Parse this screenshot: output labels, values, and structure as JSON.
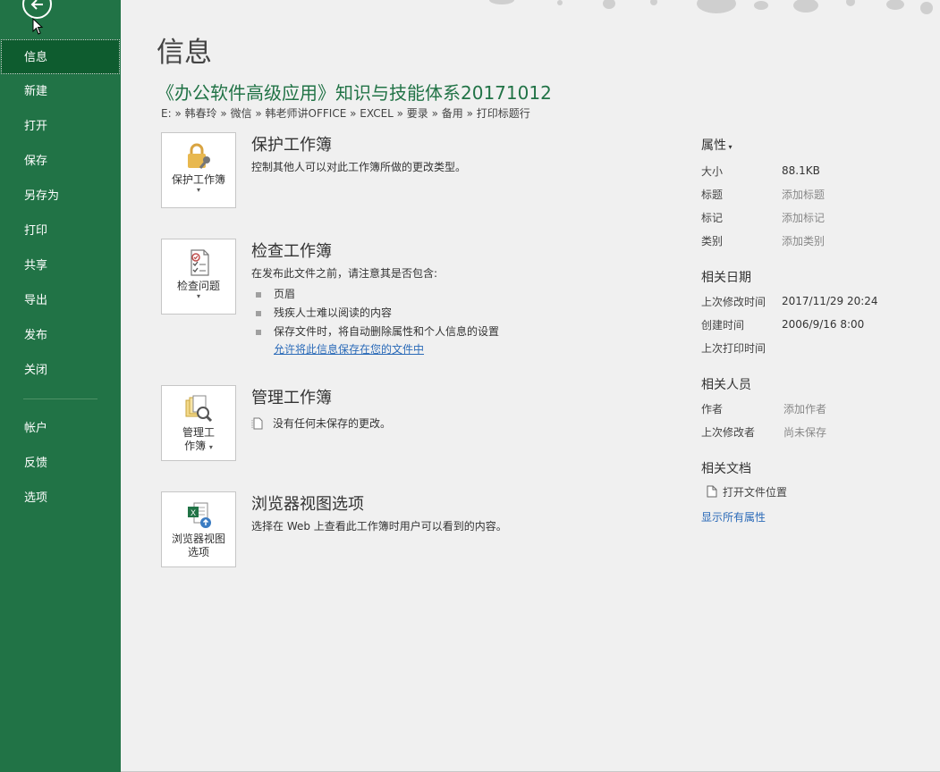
{
  "sidebar": {
    "items": [
      {
        "label": "信息",
        "active": true
      },
      {
        "label": "新建"
      },
      {
        "label": "打开"
      },
      {
        "label": "保存"
      },
      {
        "label": "另存为"
      },
      {
        "label": "打印"
      },
      {
        "label": "共享"
      },
      {
        "label": "导出"
      },
      {
        "label": "发布"
      },
      {
        "label": "关闭"
      }
    ],
    "bottom_items": [
      {
        "label": "帐户"
      },
      {
        "label": "反馈"
      },
      {
        "label": "选项"
      }
    ]
  },
  "main": {
    "page_title": "信息",
    "doc_title": "《办公软件高级应用》知识与技能体系20171012",
    "breadcrumb": "E: » 韩春玲 » 微信 » 韩老师讲OFFICE » EXCEL » 要录 » 备用 » 打印标题行",
    "protect": {
      "tile_label": "保护工作簿",
      "title": "保护工作簿",
      "desc": "控制其他人可以对此工作簿所做的更改类型。"
    },
    "inspect": {
      "tile_label": "检查问题",
      "title": "检查工作簿",
      "desc": "在发布此文件之前，请注意其是否包含:",
      "bullets": [
        "页眉",
        "残疾人士难以阅读的内容",
        "保存文件时，将自动删除属性和个人信息的设置"
      ],
      "link": "允许将此信息保存在您的文件中"
    },
    "manage": {
      "tile_label_1": "管理工",
      "tile_label_2": "作簿",
      "title": "管理工作簿",
      "status": "没有任何未保存的更改。"
    },
    "browser": {
      "tile_label_1": "浏览器视图",
      "tile_label_2": "选项",
      "title": "浏览器视图选项",
      "desc": "选择在 Web 上查看此工作簿时用户可以看到的内容。"
    }
  },
  "props": {
    "header": "属性",
    "rows": [
      {
        "k": "大小",
        "v": "88.1KB",
        "muted": false
      },
      {
        "k": "标题",
        "v": "添加标题",
        "muted": true
      },
      {
        "k": "标记",
        "v": "添加标记",
        "muted": true
      },
      {
        "k": "类别",
        "v": "添加类别",
        "muted": true
      }
    ],
    "dates_header": "相关日期",
    "dates": [
      {
        "k": "上次修改时间",
        "v": "2017/11/29 20:24"
      },
      {
        "k": "创建时间",
        "v": "2006/9/16 8:00"
      },
      {
        "k": "上次打印时间",
        "v": ""
      }
    ],
    "people_header": "相关人员",
    "people": [
      {
        "k": "作者",
        "v": "添加作者"
      },
      {
        "k": "上次修改者",
        "v": "尚未保存"
      }
    ],
    "docs_header": "相关文档",
    "open_location": "打开文件位置",
    "show_all": "显示所有属性"
  },
  "colors": {
    "sidebar": "#217346",
    "sidebar_active": "#0e5c2f",
    "accent": "#217346",
    "link": "#2a6ab8"
  }
}
